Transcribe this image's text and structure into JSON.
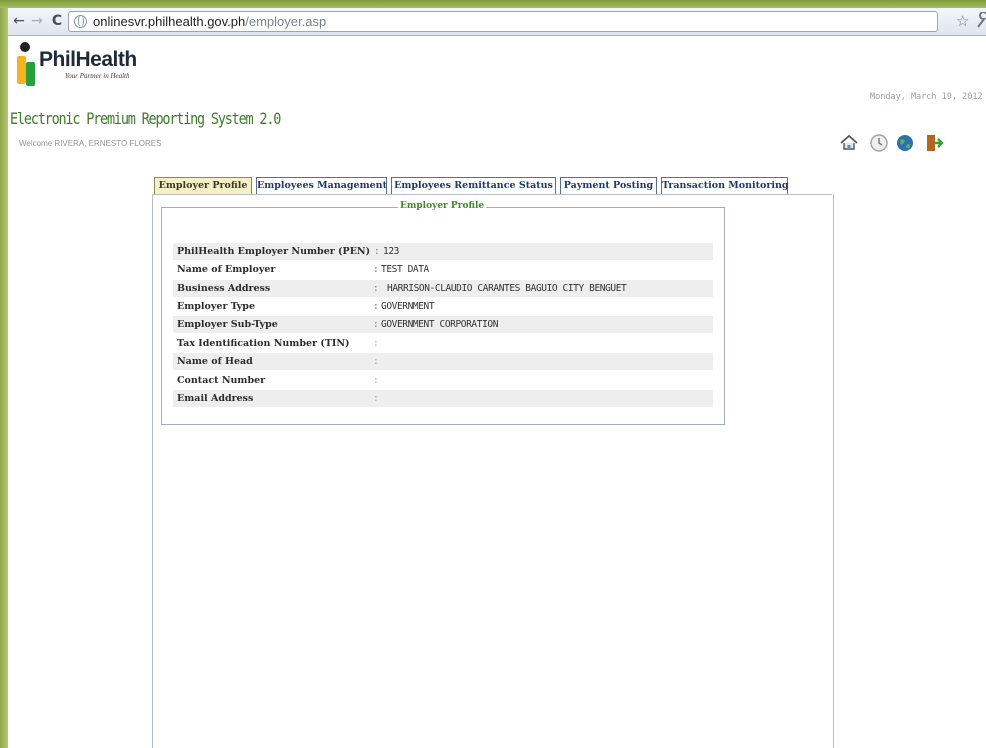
{
  "browser": {
    "url_host": "onlinesvr.philhealth.gov.ph",
    "url_path": "/employer.asp",
    "back_glyph": "←",
    "forward_glyph": "→",
    "reload_glyph": "C",
    "star_glyph": "☆",
    "menu_glyph": "🔧",
    "icons": [
      "back-arrow-icon",
      "forward-arrow-icon",
      "reload-icon",
      "page-globe-icon",
      "bookmark-star-icon",
      "wrench-icon"
    ]
  },
  "header": {
    "logo_word": "PhilHealth",
    "logo_tagline": "Your Partner in Health",
    "system_title": "Electronic Premium Reporting System 2.0",
    "welcome": "Welcome RIVERA, ERNESTO FLORES",
    "date": "Monday, March 19, 2012",
    "quick_icons": [
      "home-icon",
      "clock-icon",
      "globe-icon",
      "logout-icon"
    ]
  },
  "tabs": [
    {
      "label": "Employer Profile",
      "active": true
    },
    {
      "label": "Employees Management",
      "active": false
    },
    {
      "label": "Employees Remittance Status",
      "active": false
    },
    {
      "label": "Payment Posting",
      "active": false
    },
    {
      "label": "Transaction Monitoring",
      "active": false
    }
  ],
  "profile": {
    "legend": "Employer Profile",
    "rows": [
      {
        "label": "PhilHealth Employer Number (PEN)",
        "sep": ":",
        "value": "123"
      },
      {
        "label": "Name of Employer",
        "sep": ":",
        "value": "TEST DATA"
      },
      {
        "label": "Business Address",
        "sep": ":",
        "value": "HARRISON-CLAUDIO CARANTES BAGUIO CITY BENGUET"
      },
      {
        "label": "Employer Type",
        "sep": ":",
        "value": "GOVERNMENT"
      },
      {
        "label": "Employer Sub-Type",
        "sep": ":",
        "value": "GOVERNMENT CORPORATION"
      },
      {
        "label": "Tax Identification Number (TIN)",
        "sep": ":",
        "value": ""
      },
      {
        "label": "Name of Head",
        "sep": ":",
        "value": ""
      },
      {
        "label": "Contact Number",
        "sep": ":",
        "value": ""
      },
      {
        "label": "Email Address",
        "sep": ":",
        "value": ""
      }
    ]
  },
  "colors": {
    "frame_green": "#8fa84a",
    "system_title_green": "#3e7a2c",
    "legend_green": "#3e8a2a",
    "tab_text": "#203a66",
    "active_tab_bg": "#f6f0c8",
    "row_shade": "#eeeeee"
  }
}
